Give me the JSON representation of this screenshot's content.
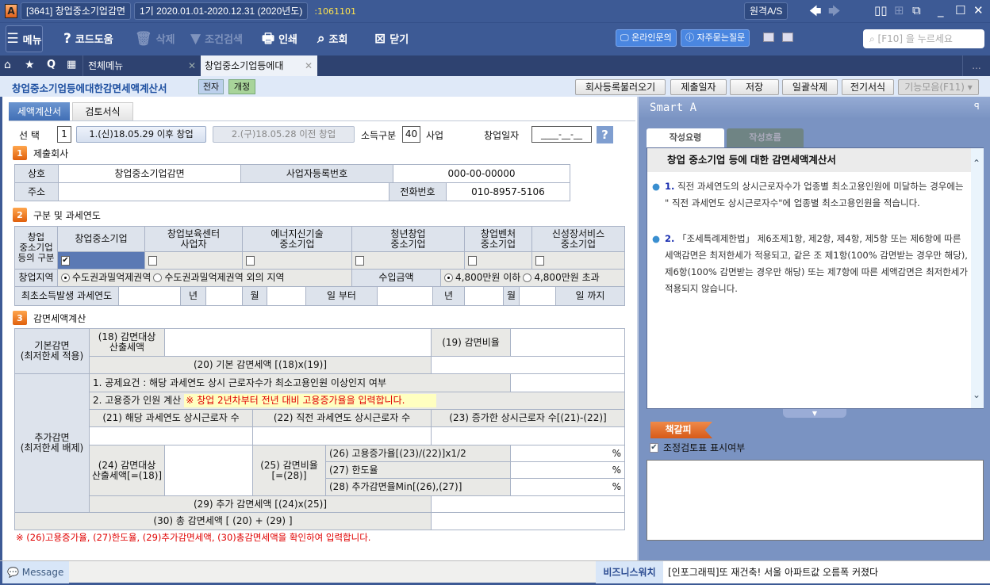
{
  "titlebar": {
    "app_icon": "A",
    "program": "[3641] 창업중소기업감면",
    "period": "1기  2020.01.01-2020.12.31",
    "year": "(2020년도)",
    "code": ":1061101",
    "remote_as": "원격A/S"
  },
  "toolbar": {
    "menu": "메뉴",
    "code_help": "코드도움",
    "delete": "삭제",
    "filter": "조건검색",
    "print": "인쇄",
    "search": "조회",
    "close": "닫기",
    "online_inquiry": "온라인문의",
    "faq": "자주묻는질문",
    "search_placeholder": "[F10] 을 누르세요"
  },
  "tabs": {
    "all_menu": "전체메뉴",
    "active": "창업중소기업등에대",
    "more": "..."
  },
  "header": {
    "title": "창업중소기업등에대한감면세액계산서",
    "badge_e": "전자",
    "badge_rev": "개정",
    "buttons": [
      "회사등록불러오기",
      "제출일자",
      "저장",
      "일괄삭제",
      "전기서식",
      "기능모음(F11)"
    ]
  },
  "form_tabs": [
    "세액계산서",
    "검토서식"
  ],
  "select_row": {
    "label": "선  택",
    "value": "1",
    "option1": "1.(신)18.05.29 이후 창업",
    "option2": "2.(구)18.05.28 이전 창업",
    "income_label": "소득구분",
    "income_value": "40",
    "income_suffix": "사업",
    "start_label": "창업일자",
    "start_value": "____-__-__",
    "help": "?"
  },
  "section1": {
    "num": "1",
    "title": "제출회사",
    "name_label": "상호",
    "name_value": "창업중소기업감면",
    "bizno_label": "사업자등록번호",
    "bizno_value": "000-00-00000",
    "addr_label": "주소",
    "addr_value": "",
    "phone_label": "전화번호",
    "phone_value": "010-8957-5106"
  },
  "section2": {
    "num": "2",
    "title": "구분 및 과세연도",
    "row_label": "창업\n중소기업\n등의 구분",
    "types": [
      {
        "label": "창업중소기업",
        "checked": true
      },
      {
        "label": "창업보육센터\n사업자",
        "checked": false
      },
      {
        "label": "에너지신기술\n중소기업",
        "checked": false
      },
      {
        "label": "청년창업\n중소기업",
        "checked": false
      },
      {
        "label": "창업벤처\n중소기업",
        "checked": false
      },
      {
        "label": "신성장서비스\n중소기업",
        "checked": false
      }
    ],
    "region_label": "창업지역",
    "region_opt1": "수도권과밀억제권역",
    "region_opt2": "수도권과밀억제권역 외의 지역",
    "revenue_label": "수입금액",
    "rev_opt1": "4,800만원 이하",
    "rev_opt2": "4,800만원 초과",
    "first_label": "최초소득발생 과세연도",
    "year": "년",
    "month": "월",
    "from": "일 부터",
    "to": "일 까지"
  },
  "section3": {
    "num": "3",
    "title": "감면세액계산",
    "basic": "기본감면\n(최저한세 적용)",
    "l18": "(18) 감면대상\n산출세액",
    "l19": "(19) 감면비율",
    "l20": "(20) 기본 감면세액 [(18)x(19)]",
    "extra": "추가감면\n(최저한세 배제)",
    "req1": "1. 공제요건 : 해당 과세연도 상시 근로자수가 최소고용인원 이상인지 여부",
    "req2": "2. 고용증가 인원 계산",
    "req2_note": "※ 창업 2년차부터 전년 대비 고용증가율을 입력합니다.",
    "l21": "(21) 해당 과세연도 상시근로자 수",
    "l22": "(22) 직전 과세연도 상시근로자 수",
    "l23": "(23) 증가한 상시근로자 수[(21)-(22)]",
    "l24": "(24) 감면대상\n산출세액[=(18)]",
    "l25": "(25) 감면비율\n[=(28)]",
    "l26": "(26) 고용증가율[(23)/(22)]x1/2",
    "l27": "(27) 한도율",
    "l28": "(28) 추가감면율Min[(26),(27)]",
    "pct": "%",
    "l29": "(29) 추가 감면세액 [(24)x(25)]",
    "l30": "(30) 총 감면세액 [ (20) + (29) ]",
    "footnote": "※ (26)고용증가율, (27)한도율, (29)추가감면세액, (30)총감면세액을 확인하여 입력합니다."
  },
  "smart": {
    "title": "Smart A",
    "tab1": "작성요령",
    "tab2": "작성흐름",
    "heading": "창업 중소기업 등에 대한 감면세액계산서",
    "items": [
      {
        "n": "1.",
        "text": "직전 과세연도의 상시근로자수가 업종별 최소고용인원에 미달하는 경우에는 \" 직전 과세연도 상시근로자수\"에 업종별 최소고용인원을 적습니다."
      },
      {
        "n": "2.",
        "text": "「조세특례제한법」 제6조제1항, 제2항, 제4항, 제5항 또는 제6항에 따른 세액감면은 최저한세가 적용되고, 같은 조 제1항(100% 감면받는 경우만 해당), 제6항(100% 감면받는 경우만 해당) 또는 제7항에 따른 세액감면은 최저한세가 적용되지 않습니다."
      }
    ],
    "bookmark": "책갈피",
    "review_check": "조정검토표 표시여부"
  },
  "status": {
    "message": "Message",
    "news_label": "비즈니스워치",
    "news": "[인포그래픽]또 재건축! 서울 아파트값 오름폭 커졌다"
  }
}
